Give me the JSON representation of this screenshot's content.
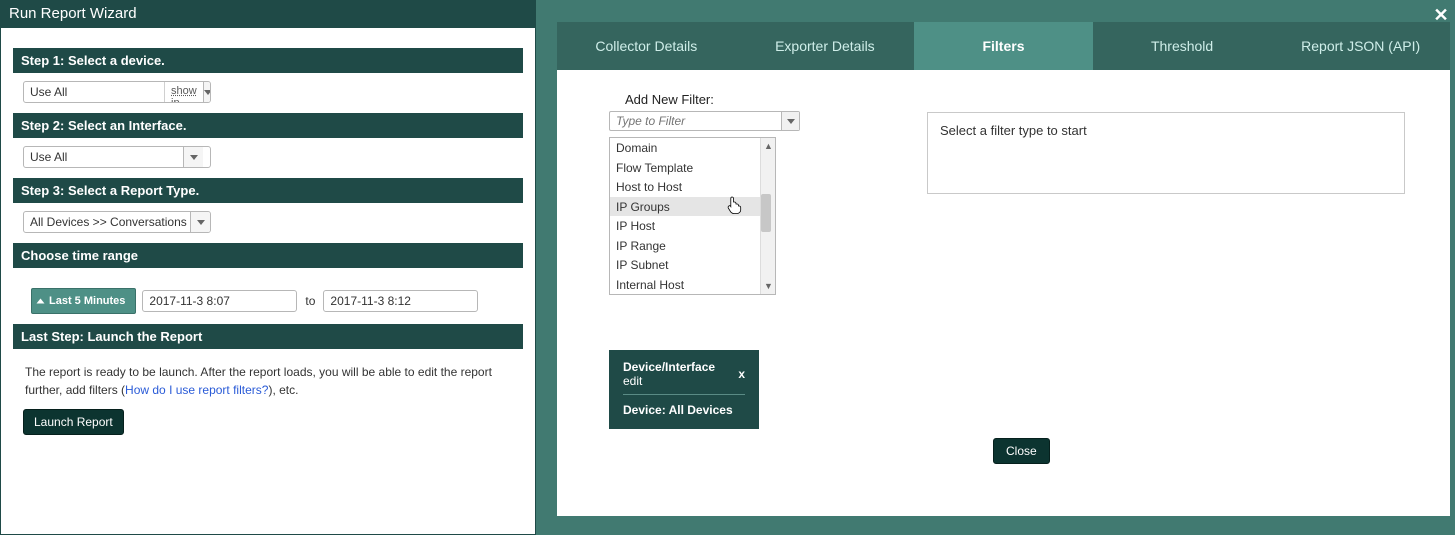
{
  "left": {
    "title": "Run Report Wizard",
    "step1": {
      "header": "Step 1: Select a device.",
      "value": "Use All",
      "extra": "show ip"
    },
    "step2": {
      "header": "Step 2: Select an Interface.",
      "value": "Use All"
    },
    "step3": {
      "header": "Step 3: Select a Report Type.",
      "value": "All Devices >> Conversations"
    },
    "timerange": {
      "header": "Choose time range",
      "preset": "Last 5 Minutes",
      "from": "2017-11-3 8:07",
      "to_label": "to",
      "to": "2017-11-3 8:12"
    },
    "last": {
      "header": "Last Step: Launch the Report",
      "text1": "The report is ready to be launch. After the report loads, you will be able to edit the report further, add filters (",
      "link": "How do I use report filters?",
      "text2": "), etc.",
      "button": "Launch Report"
    }
  },
  "right": {
    "tabs": [
      "Collector Details",
      "Exporter Details",
      "Filters",
      "Threshold",
      "Report JSON (API)"
    ],
    "active_tab_index": 2,
    "add_filter_label": "Add New Filter:",
    "filter_placeholder": "Type to Filter",
    "options": [
      "Domain",
      "Flow Template",
      "Host to Host",
      "IP Groups",
      "IP Host",
      "IP Range",
      "IP Subnet",
      "Internal Host"
    ],
    "hover_index": 3,
    "info_text": "Select a filter type to start",
    "chip": {
      "title": "Device/Interface",
      "edit": "edit",
      "close": "x",
      "body": "Device: All Devices"
    },
    "close_button": "Close"
  }
}
